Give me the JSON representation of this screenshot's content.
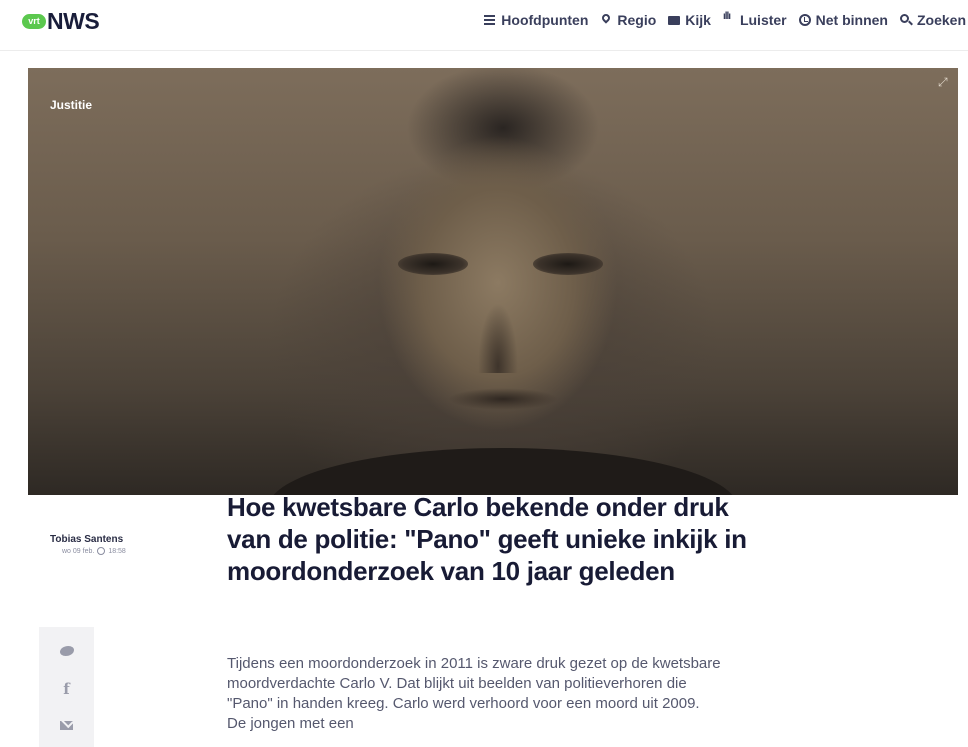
{
  "brand": {
    "badge": "vrt",
    "name": "NWS",
    "colors": {
      "badge": "#5bc84e",
      "text": "#191d3a"
    }
  },
  "nav": {
    "items": [
      {
        "label": "Hoofdpunten",
        "icon": "list-icon"
      },
      {
        "label": "Regio",
        "icon": "map-pin-icon"
      },
      {
        "label": "Kijk",
        "icon": "tv-icon"
      },
      {
        "label": "Luister",
        "icon": "audio-wave-icon"
      },
      {
        "label": "Net binnen",
        "icon": "clock-icon"
      },
      {
        "label": "Zoeken",
        "icon": "search-icon"
      }
    ]
  },
  "hero": {
    "category": "Justitie",
    "expand_icon": "expand-icon"
  },
  "byline": {
    "author": "Tobias Santens",
    "date": "wo 09 feb.",
    "time": "18:58"
  },
  "share": {
    "icons": [
      "twitter-icon",
      "facebook-icon",
      "mail-icon"
    ]
  },
  "article": {
    "headline": "Hoe kwetsbare Carlo bekende onder druk van de politie: \"Pano\" geeft unieke inkijk in moordonderzoek van 10 jaar geleden",
    "lead": "Tijdens een moordonderzoek in 2011 is zware druk gezet op de kwetsbare moordverdachte Carlo V. Dat blijkt uit beelden van politieverhoren die \"Pano\" in handen kreeg. Carlo werd verhoord voor een moord uit 2009. De jongen met een"
  }
}
